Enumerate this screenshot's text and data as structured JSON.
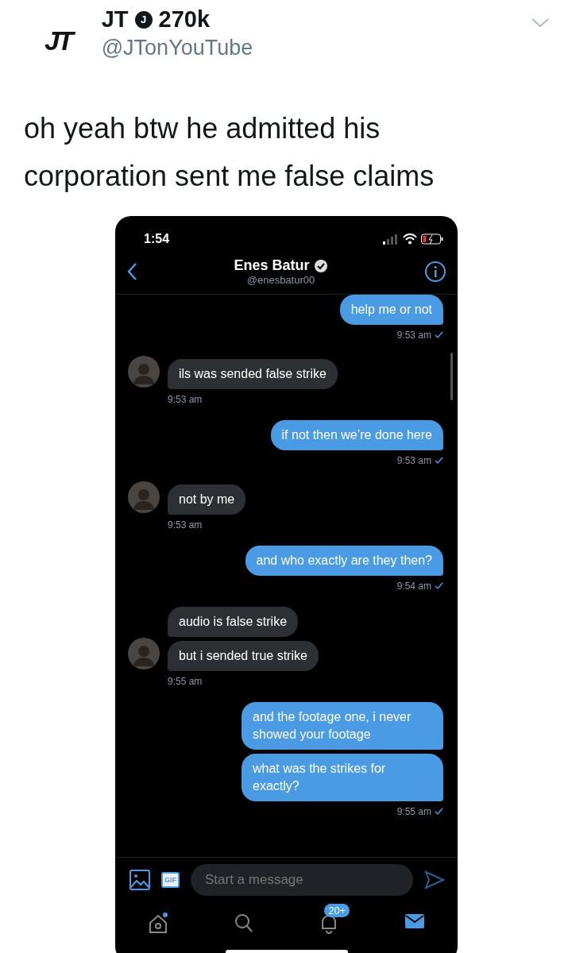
{
  "tweet": {
    "logo": "JT",
    "name": "JT",
    "badge": "J",
    "followers": "270k",
    "handle": "@JTonYouTube",
    "text": "oh yeah btw he admitted his corporation sent me false claims"
  },
  "phone": {
    "status_time": "1:54",
    "contact": {
      "name": "Enes Batur",
      "handle": "@enesbatur00"
    },
    "messages": [
      {
        "kind": "sent",
        "bubbles": [
          "help me or not"
        ],
        "time": "9:53 am",
        "read": true
      },
      {
        "kind": "received",
        "bubbles": [
          "ils was sended false strike"
        ],
        "time": "9:53 am"
      },
      {
        "kind": "sent",
        "bubbles": [
          "if not then we’re done here"
        ],
        "time": "9:53 am",
        "read": true
      },
      {
        "kind": "received",
        "bubbles": [
          "not by me"
        ],
        "time": "9:53 am"
      },
      {
        "kind": "sent",
        "bubbles": [
          "and who exactly are they then?"
        ],
        "time": "9:54 am",
        "read": true
      },
      {
        "kind": "received",
        "bubbles": [
          "audio is false strike",
          "but i sended true strike"
        ],
        "time": "9:55 am"
      },
      {
        "kind": "sent",
        "bubbles": [
          "and the footage one, i never showed your footage",
          "what was the strikes for exactly?"
        ],
        "time": "9:55 am",
        "read": true
      }
    ],
    "composer": {
      "gif": "GIF",
      "placeholder": "Start a message"
    },
    "tabs": [
      {
        "kind": "home",
        "selected": false,
        "dot": true
      },
      {
        "kind": "search",
        "selected": false
      },
      {
        "kind": "notifications",
        "selected": false,
        "badge": "20+"
      },
      {
        "kind": "messages",
        "selected": true
      }
    ]
  }
}
